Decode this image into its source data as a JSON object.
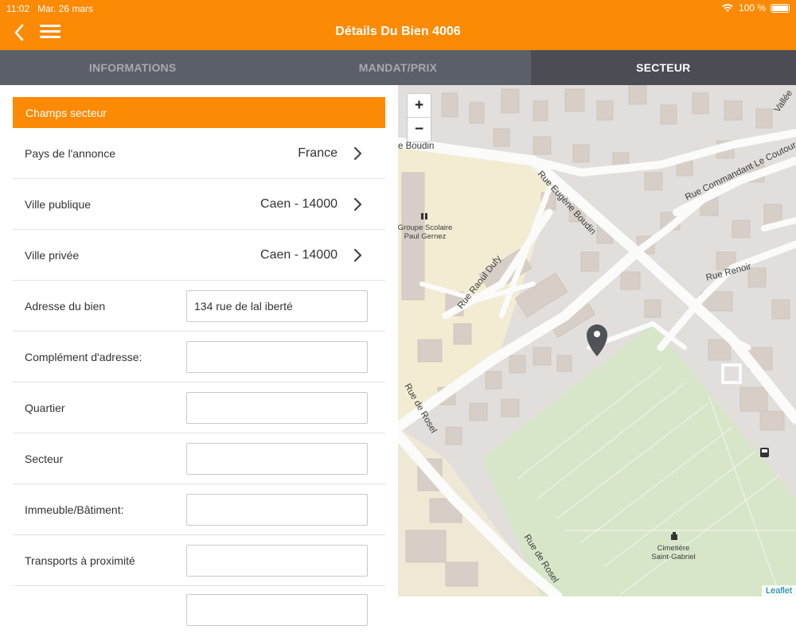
{
  "status": {
    "time": "11:02",
    "date": "Mar. 26 mars",
    "battery": "100 %"
  },
  "header": {
    "title": "Détails Du Bien 4006"
  },
  "tabs": [
    {
      "label": "INFORMATIONS",
      "active": false
    },
    {
      "label": "MANDAT/PRIX",
      "active": false
    },
    {
      "label": "SECTEUR",
      "active": true
    }
  ],
  "form": {
    "section_title": "Champs secteur",
    "pays_label": "Pays de l'annonce",
    "pays_value": "France",
    "ville_publique_label": "Ville publique",
    "ville_publique_value": "Caen - 14000",
    "ville_privee_label": "Ville privée",
    "ville_privee_value": "Caen - 14000",
    "adresse_label": "Adresse du bien",
    "adresse_value": "134 rue de lal iberté",
    "complement_label": "Complément d'adresse:",
    "complement_value": "",
    "quartier_label": "Quartier",
    "quartier_value": "",
    "secteur_label": "Secteur",
    "secteur_value": "",
    "immeuble_label": "Immeuble/Bâtiment:",
    "immeuble_value": "",
    "transports_label": "Transports à proximité",
    "transports_value": ""
  },
  "map": {
    "zoom_in": "+",
    "zoom_out": "−",
    "attribution": "Leaflet",
    "labels": {
      "rue_boudin": "e Boudin",
      "rue_eugene_boudin": "Rue Eugène Boudin",
      "rue_commandant": "Rue Commandant Le Coutour",
      "rue_vallee": "Vallée",
      "rue_raoul_dufy": "Rue Raoul Dufy",
      "rue_renoir": "Rue Renoir",
      "rue_rosel_1": "Rue de Rosel",
      "rue_rosel_2": "Rue de Rosel",
      "school_1": "Groupe Scolaire",
      "school_2": "Paul Gernez",
      "cemetery_1": "Cimetière",
      "cemetery_2": "Saint-Gabriel"
    },
    "colors": {
      "land": "#e2dedb",
      "road": "#fbfbfa",
      "building": "#d7cfc7",
      "park": "#d7e6c9",
      "school": "#f2ecd3",
      "marker": "#4f5257"
    }
  },
  "colors": {
    "accent": "#fd8a05",
    "tabbar": "#5b5f68",
    "tab_active": "#4a4d54"
  }
}
